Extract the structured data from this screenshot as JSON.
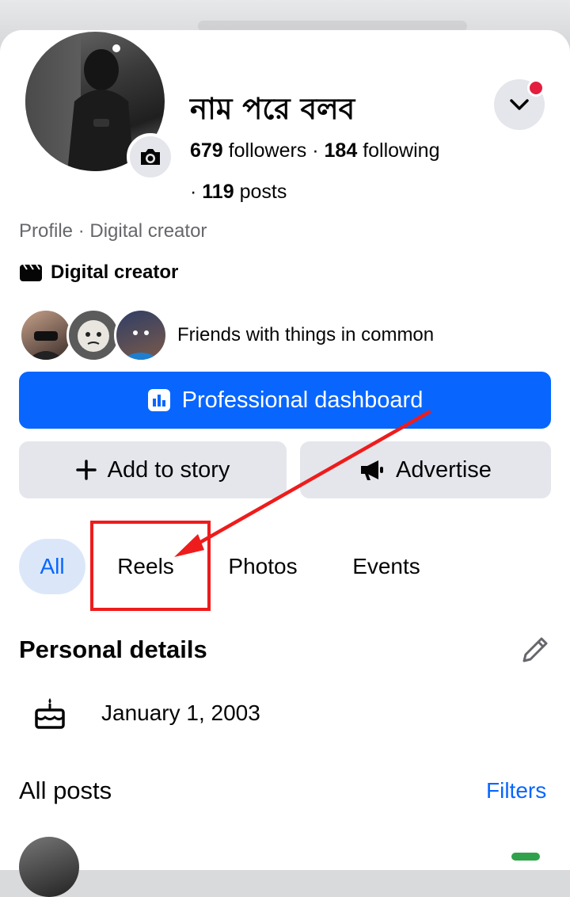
{
  "profile": {
    "name": "নাম পরে বলব",
    "followers_count": "679",
    "followers_label": " followers · ",
    "following_count": "184",
    "following_label": " following",
    "posts_prefix": "· ",
    "posts_count": "119",
    "posts_label": " posts",
    "category_line": "Profile · Digital creator",
    "creator_label": "Digital creator",
    "friends_text": "Friends with things in common"
  },
  "actions": {
    "dashboard_label": "Professional dashboard",
    "add_story_label": "Add to story",
    "advertise_label": "Advertise"
  },
  "tabs": [
    {
      "label": "All",
      "active": true
    },
    {
      "label": "Reels",
      "active": false
    },
    {
      "label": "Photos",
      "active": false
    },
    {
      "label": "Events",
      "active": false
    }
  ],
  "personal_details": {
    "title": "Personal details",
    "birthday": "January 1, 2003"
  },
  "posts_section": {
    "title": "All posts",
    "filters_label": "Filters"
  },
  "colors": {
    "brand_blue": "#0866ff",
    "annotation_red": "#ee1c1c",
    "notification_red": "#e41e3f"
  }
}
